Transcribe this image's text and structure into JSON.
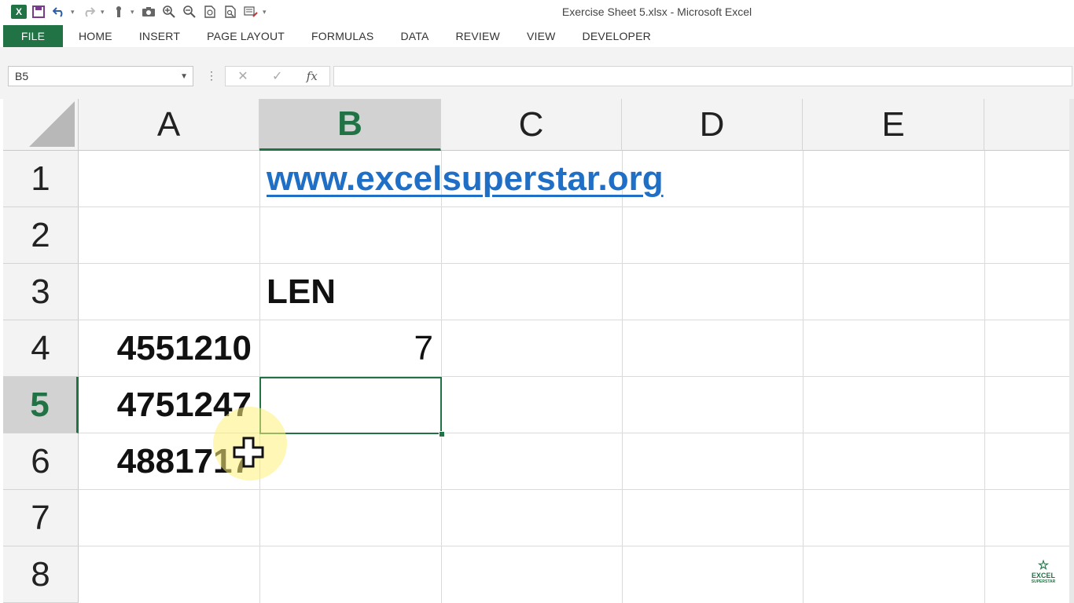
{
  "window": {
    "title": "Exercise Sheet 5.xlsx - Microsoft Excel"
  },
  "quick_access": [
    {
      "name": "excel-logo-icon",
      "glyph": "X"
    },
    {
      "name": "save-icon",
      "glyph": "🖫"
    },
    {
      "name": "undo-icon",
      "glyph": "↶"
    },
    {
      "name": "redo-icon",
      "glyph": "↷"
    },
    {
      "name": "touch-mode-icon",
      "glyph": "✋"
    },
    {
      "name": "camera-icon",
      "glyph": "📷"
    },
    {
      "name": "zoom-in-icon",
      "glyph": "🔍"
    },
    {
      "name": "zoom-out-icon",
      "glyph": "🔎"
    },
    {
      "name": "print-preview-icon",
      "glyph": "🗋"
    },
    {
      "name": "page-zoom-icon",
      "glyph": "🗋"
    },
    {
      "name": "format-icon",
      "glyph": "✎"
    }
  ],
  "ribbon": {
    "tabs": [
      "FILE",
      "HOME",
      "INSERT",
      "PAGE LAYOUT",
      "FORMULAS",
      "DATA",
      "REVIEW",
      "VIEW",
      "DEVELOPER"
    ]
  },
  "formula_bar": {
    "name_box": "B5",
    "cancel_glyph": "✕",
    "enter_glyph": "✓",
    "fx_label": "fx",
    "formula": ""
  },
  "sheet": {
    "columns": [
      "A",
      "B",
      "C",
      "D",
      "E"
    ],
    "selected_column": "B",
    "rows": [
      "1",
      "2",
      "3",
      "4",
      "5",
      "6",
      "7",
      "8"
    ],
    "selected_row": "5",
    "cells": {
      "B1": "www.excelsuperstar.org",
      "B3": "LEN",
      "A4": "4551210",
      "B4": "7",
      "A5": "4751247",
      "A6": "4881717"
    },
    "active_cell": "B5"
  },
  "watermark": {
    "line1": "EXCEL",
    "line2": "SUPERSTAR"
  },
  "colors": {
    "accent": "#217346",
    "link": "#1f6fc6"
  }
}
